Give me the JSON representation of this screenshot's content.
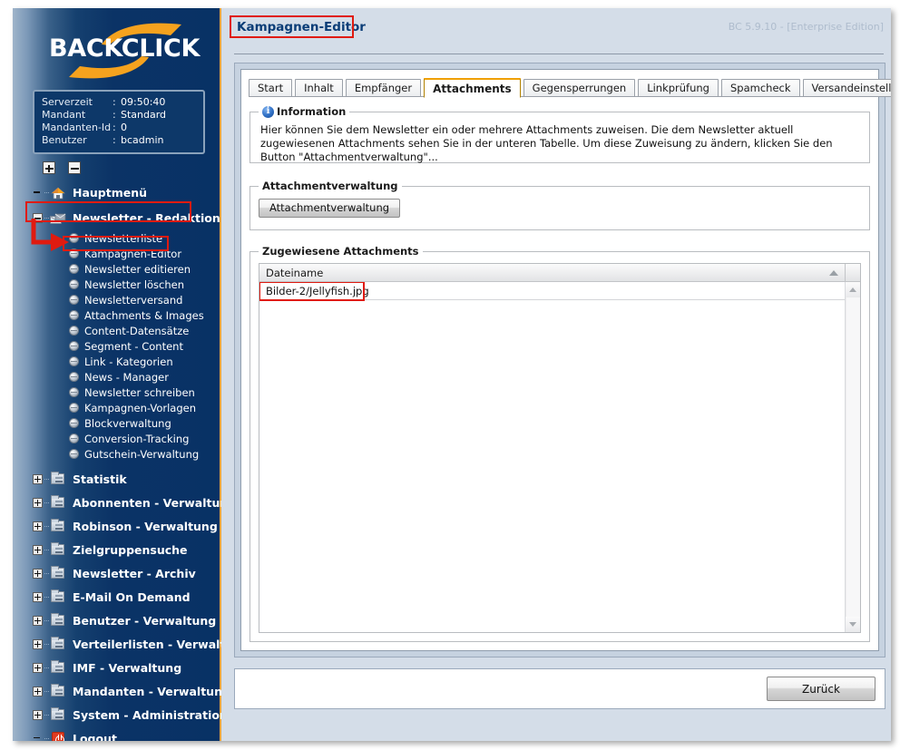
{
  "brand": {
    "logo_text": "BACKCLICK",
    "accent": "#f5a21e"
  },
  "server_info": {
    "rows": [
      {
        "key": "Serverzeit",
        "sep": ":",
        "value": "09:50:40"
      },
      {
        "key": "Mandant",
        "sep": ":",
        "value": "Standard"
      },
      {
        "key": "Mandanten-Id",
        "sep": ":",
        "value": "0"
      },
      {
        "key": "Benutzer",
        "sep": ":",
        "value": "bcadmin"
      }
    ]
  },
  "tree_tools": {
    "expand_all": "+",
    "collapse_all": "-"
  },
  "sidebar": {
    "items": [
      {
        "label": "Hauptmenü",
        "icon": "house-icon",
        "expander": "none",
        "level": 0
      },
      {
        "label": "Newsletter - Redaktion",
        "icon": "mailstack-icon",
        "expander": "minus",
        "level": 0,
        "highlight": true
      },
      {
        "label": "Statistik",
        "icon": "folder-icon",
        "expander": "plus",
        "level": 0
      },
      {
        "label": "Abonnenten - Verwaltung",
        "icon": "folder-icon",
        "expander": "plus",
        "level": 0
      },
      {
        "label": "Robinson - Verwaltung",
        "icon": "folder-icon",
        "expander": "plus",
        "level": 0
      },
      {
        "label": "Zielgruppensuche",
        "icon": "folder-icon",
        "expander": "plus",
        "level": 0
      },
      {
        "label": "Newsletter - Archiv",
        "icon": "folder-icon",
        "expander": "plus",
        "level": 0
      },
      {
        "label": "E-Mail On Demand",
        "icon": "folder-icon",
        "expander": "plus",
        "level": 0
      },
      {
        "label": "Benutzer - Verwaltung",
        "icon": "folder-icon",
        "expander": "plus",
        "level": 0
      },
      {
        "label": "Verteilerlisten - Verwaltung",
        "icon": "folder-icon",
        "expander": "plus",
        "level": 0
      },
      {
        "label": "IMF - Verwaltung",
        "icon": "folder-icon",
        "expander": "plus",
        "level": 0
      },
      {
        "label": "Mandanten - Verwaltung",
        "icon": "folder-icon",
        "expander": "plus",
        "level": 0
      },
      {
        "label": "System - Administration",
        "icon": "folder-icon",
        "expander": "plus",
        "level": 0
      },
      {
        "label": "Logout",
        "icon": "logout-icon",
        "expander": "none",
        "level": 0
      }
    ],
    "subitems": [
      {
        "label": "Newsletterliste"
      },
      {
        "label": "Kampagnen-Editor",
        "highlight": true
      },
      {
        "label": "Newsletter editieren"
      },
      {
        "label": "Newsletter löschen"
      },
      {
        "label": "Newsletterversand"
      },
      {
        "label": "Attachments & Images"
      },
      {
        "label": "Content-Datensätze"
      },
      {
        "label": "Segment - Content"
      },
      {
        "label": "Link - Kategorien"
      },
      {
        "label": "News - Manager"
      },
      {
        "label": "Newsletter schreiben"
      },
      {
        "label": "Kampagnen-Vorlagen"
      },
      {
        "label": "Blockverwaltung"
      },
      {
        "label": "Conversion-Tracking"
      },
      {
        "label": "Gutschein-Verwaltung"
      }
    ]
  },
  "header": {
    "title": "Kampagnen-Editor",
    "edition": "BC 5.9.10 - [Enterprise Edition]"
  },
  "tabs": {
    "items": [
      {
        "label": "Start",
        "active": false
      },
      {
        "label": "Inhalt",
        "active": false
      },
      {
        "label": "Empfänger",
        "active": false
      },
      {
        "label": "Attachments",
        "active": true
      },
      {
        "label": "Gegensperrungen",
        "active": false
      },
      {
        "label": "Linkprüfung",
        "active": false
      },
      {
        "label": "Spamcheck",
        "active": false
      },
      {
        "label": "Versandeinstellungen",
        "active": false
      }
    ],
    "nav_prev": "◄",
    "nav_next": "►"
  },
  "information": {
    "legend": "Information",
    "icon_glyph": "i",
    "text": "Hier können Sie dem Newsletter ein oder mehrere Attachments zuweisen. Die dem Newsletter aktuell zugewiesenen Attachments sehen Sie in der unteren Tabelle. Um diese Zuweisung zu ändern, klicken Sie den Button \"Attachmentverwaltung\"..."
  },
  "attachment_management": {
    "legend": "Attachmentverwaltung",
    "button_label": "Attachmentverwaltung"
  },
  "assigned_attachments": {
    "legend": "Zugewiesene Attachments",
    "columns": [
      "Dateiname"
    ],
    "sort_indicator": "ascending",
    "rows": [
      {
        "filename": "Bilder-2/Jellyfish.jpg",
        "highlight": true
      }
    ]
  },
  "footer": {
    "back_label": "Zurück"
  },
  "annotations": {
    "highlight_color": "#e01b10"
  }
}
